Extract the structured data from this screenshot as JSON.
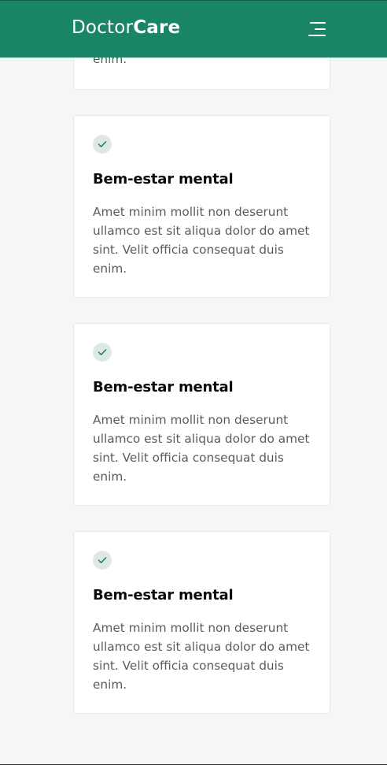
{
  "header": {
    "logo_light": "Doctor",
    "logo_bold": "Care",
    "menu_icon": "hamburger-menu-icon"
  },
  "colors": {
    "brand": "#1a8566",
    "background": "#f5f7f6",
    "check_bg": "#dde8e4"
  },
  "partial_card": {
    "text_tail": "enim."
  },
  "cards": [
    {
      "icon": "check-icon",
      "title": "Bem-estar mental",
      "text": "Amet minim mollit non deserunt ullamco est sit aliqua dolor do amet sint. Velit officia consequat duis enim."
    },
    {
      "icon": "check-icon",
      "title": "Bem-estar mental",
      "text": "Amet minim mollit non deserunt ullamco est sit aliqua dolor do amet sint. Velit officia consequat duis enim."
    },
    {
      "icon": "check-icon",
      "title": "Bem-estar mental",
      "text": "Amet minim mollit non deserunt ullamco est sit aliqua dolor do amet sint. Velit officia consequat duis enim."
    }
  ]
}
